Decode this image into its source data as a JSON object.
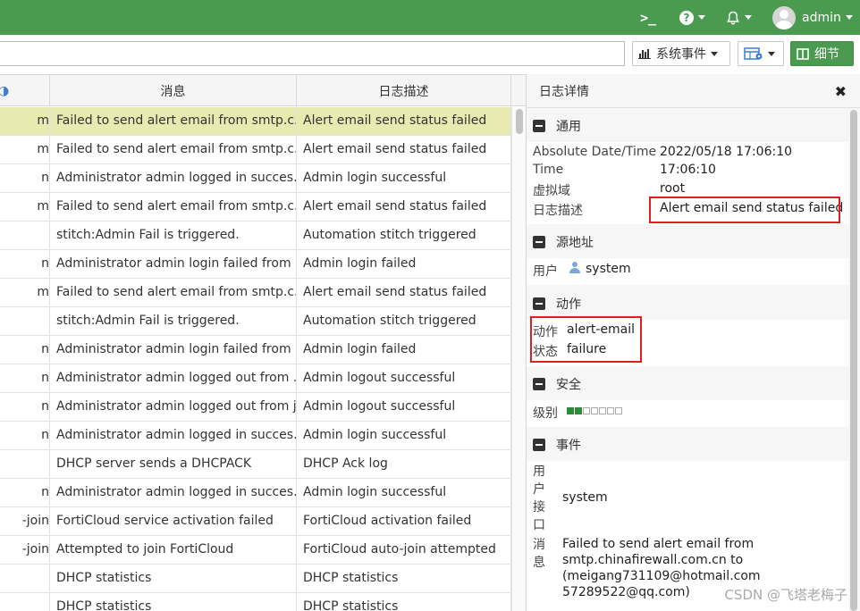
{
  "topbar": {
    "terminal_icon": "terminal-icon",
    "help_icon": "question-circle-icon",
    "bell_icon": "bell-icon",
    "user": "admin"
  },
  "toolbar": {
    "search_value": "",
    "events_label": "系统事件",
    "details_label": "细节"
  },
  "table": {
    "columns": [
      "",
      "消息",
      "日志描述"
    ],
    "rows": [
      {
        "c1": "m",
        "msg": "Failed to send alert email from smtp.c...",
        "desc": "Alert email send status failed",
        "selected": true
      },
      {
        "c1": "m",
        "msg": "Failed to send alert email from smtp.c...",
        "desc": "Alert email send status failed"
      },
      {
        "c1": "n",
        "msg": "Administrator admin logged in succes...",
        "desc": "Admin login successful"
      },
      {
        "c1": "m",
        "msg": "Failed to send alert email from smtp.c...",
        "desc": "Alert email send status failed"
      },
      {
        "c1": "",
        "msg": "stitch:Admin Fail is triggered.",
        "desc": "Automation stitch triggered"
      },
      {
        "c1": "n",
        "msg": "Administrator admin login failed from ...",
        "desc": "Admin login failed"
      },
      {
        "c1": "m",
        "msg": "Failed to send alert email from smtp.c...",
        "desc": "Alert email send status failed"
      },
      {
        "c1": "",
        "msg": "stitch:Admin Fail is triggered.",
        "desc": "Automation stitch triggered"
      },
      {
        "c1": "n",
        "msg": "Administrator admin login failed from ...",
        "desc": "Admin login failed"
      },
      {
        "c1": "n",
        "msg": "Administrator admin logged out from ...",
        "desc": "Admin logout successful"
      },
      {
        "c1": "n",
        "msg": "Administrator admin logged out from j...",
        "desc": "Admin logout successful"
      },
      {
        "c1": "n",
        "msg": "Administrator admin logged in succes...",
        "desc": "Admin login successful"
      },
      {
        "c1": "",
        "msg": "DHCP server sends a DHCPACK",
        "desc": "DHCP Ack log"
      },
      {
        "c1": "n",
        "msg": "Administrator admin logged in succes...",
        "desc": "Admin login successful"
      },
      {
        "c1": "-join",
        "msg": "FortiCloud service activation failed",
        "desc": "FortiCloud activation failed"
      },
      {
        "c1": "-join",
        "msg": "Attempted to join FortiCloud",
        "desc": "FortiCloud auto-join attempted"
      },
      {
        "c1": "",
        "msg": "DHCP statistics",
        "desc": "DHCP statistics"
      },
      {
        "c1": "",
        "msg": "DHCP statistics",
        "desc": "DHCP statistics"
      }
    ]
  },
  "panel": {
    "title": "日志详情",
    "general": {
      "title": "通用",
      "abs_label": "Absolute Date/Time",
      "abs_value": "2022/05/18 17:06:10",
      "time_label": "Time",
      "time_value": "17:06:10",
      "vdom_label": "虚拟域",
      "vdom_value": "root",
      "desc_label": "日志描述",
      "desc_value": "Alert email send status failed"
    },
    "source": {
      "title": "源地址",
      "user_label": "用户",
      "user_value": "system"
    },
    "action": {
      "title": "动作",
      "action_label": "动作",
      "action_value": "alert-email",
      "status_label": "状态",
      "status_value": "failure"
    },
    "security": {
      "title": "安全",
      "level_label": "级别",
      "level": 2,
      "level_max": 7
    },
    "event": {
      "title": "事件",
      "user_if_label": [
        "用",
        "户",
        "接",
        "口"
      ],
      "user_if_value": "system",
      "msg_label": [
        "消",
        "息"
      ],
      "msg_value": [
        "Failed to send alert email from",
        "smtp.chinafirewall.com.cn to",
        "(meigang731109@hotmail.com",
        "57289522@qq.com)"
      ]
    }
  },
  "watermark": "CSDN @飞塔老梅子"
}
